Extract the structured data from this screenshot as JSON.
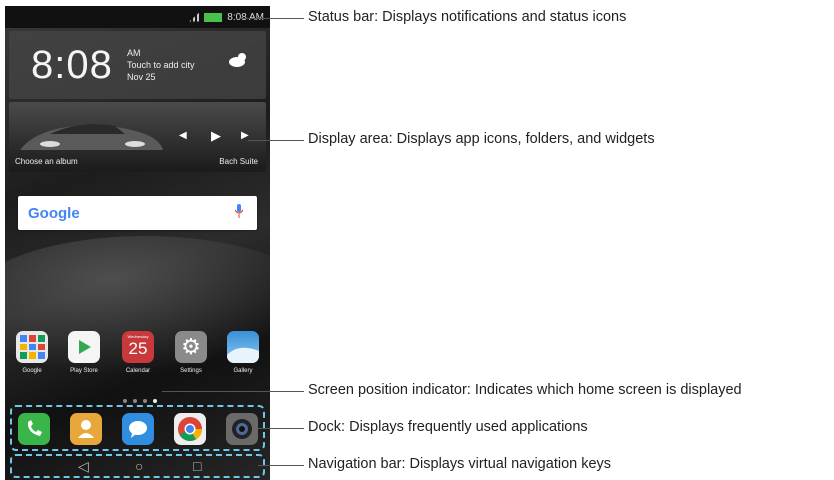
{
  "status_bar": {
    "time": "8:08 AM"
  },
  "clock_widget": {
    "time": "8:08",
    "ampm": "AM",
    "city_hint": "Touch to add city",
    "date": "Nov 25"
  },
  "album_widget": {
    "album_hint": "Choose an album",
    "track": "Bach Suite"
  },
  "search_bar": {
    "logo": "Google"
  },
  "apps": [
    {
      "label": "Google",
      "icon": "google-folder-icon"
    },
    {
      "label": "Play Store",
      "icon": "play-store-icon"
    },
    {
      "label": "Calendar",
      "icon": "calendar-icon",
      "day": "25",
      "weekday": "Wednesday"
    },
    {
      "label": "Settings",
      "icon": "settings-icon"
    },
    {
      "label": "Gallery",
      "icon": "gallery-icon"
    }
  ],
  "dock": [
    "phone-icon",
    "contacts-icon",
    "messages-icon",
    "chrome-icon",
    "camera-icon"
  ],
  "nav_keys": [
    "back-icon",
    "home-icon",
    "recents-icon"
  ],
  "callouts": {
    "status_bar": "Status bar: Displays notifications and status icons",
    "display_area": "Display area: Displays app icons, folders, and widgets",
    "screen_indicator": "Screen position indicator: Indicates which home screen is displayed",
    "dock": "Dock: Displays frequently used applications",
    "nav_bar": "Navigation bar: Displays virtual navigation keys"
  },
  "colors": {
    "dashed_outline": "#6ec6e8",
    "battery": "#49c24b"
  }
}
